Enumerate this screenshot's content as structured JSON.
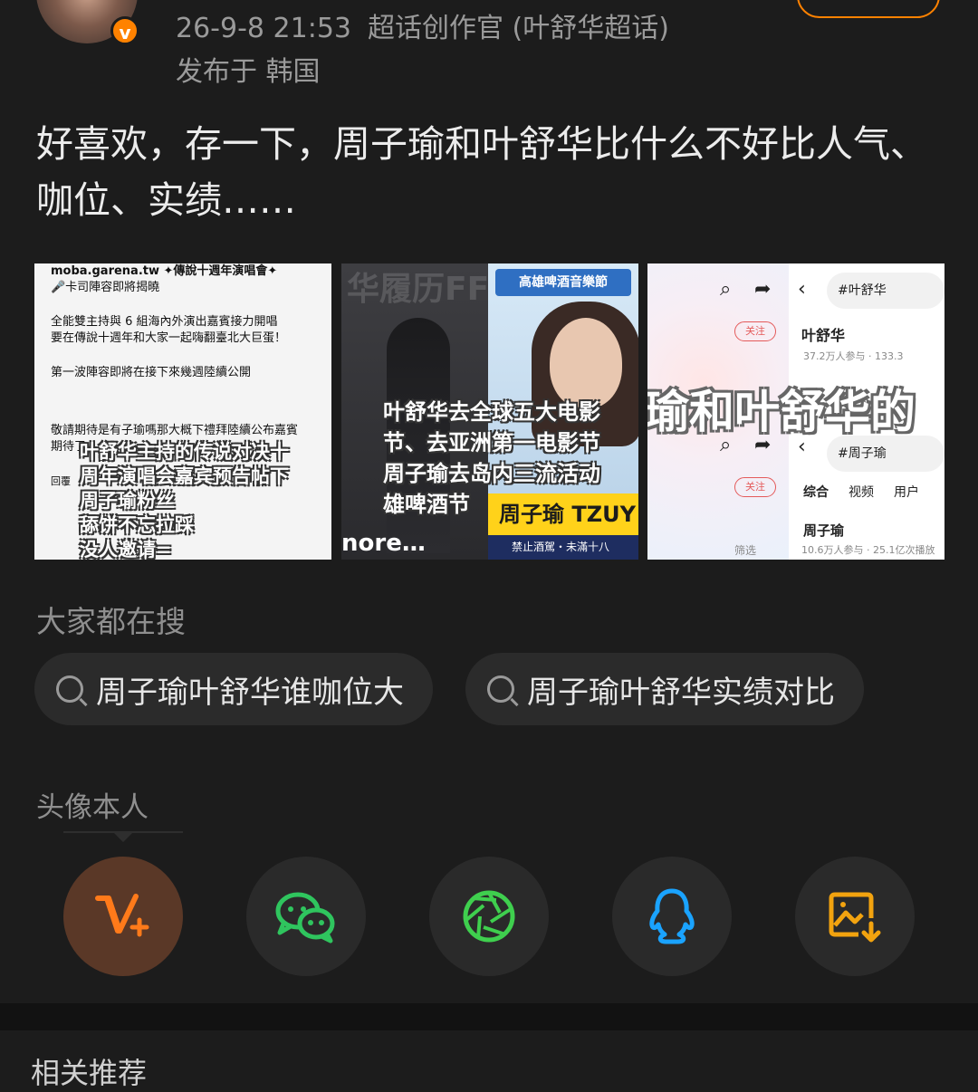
{
  "post": {
    "timestamp": "26-9-8 21:53",
    "source": "超话创作官 (叶舒华超话)",
    "location": "发布于 韩国",
    "text": "好喜欢，存一下，周子瑜和叶舒华比什么不好比人气、咖位、实绩……",
    "badge": "v"
  },
  "images": {
    "img1": {
      "lines": [
        "moba.garena.tw ✦傳說十週年演唱會✦",
        "🎤卡司陣容即將揭曉",
        "全能雙主持與 6 組海內外演出嘉賓接力開唱",
        "要在傳說十週年和大家一起嗨翻臺北大巨蛋！",
        "第一波陣容即將在接下來幾週陸續公開",
        "敬請期待是有子瑜嗎那大概下禮拜陸續公布嘉賓",
        "期待了",
        "回覆"
      ],
      "overlay": [
        "叶舒华主持的传说对决十",
        "周年演唱会嘉宾预告帖下",
        "周子瑜粉丝",
        "舔饼不忘拉踩",
        "没人邀请="
      ]
    },
    "img2": {
      "fest": "高雄啤酒音樂節",
      "watermark": "华履历FF",
      "overlay": [
        "叶舒华去全球五大电影",
        "节、去亚洲第一电影节",
        "周子瑜去岛内三流活动",
        "雄啤酒节"
      ],
      "name_tag": "周子瑜 TZUY",
      "more": "nore…",
      "strip": "禁止酒駕・未滿十八"
    },
    "img3": {
      "search1": "#叶舒华",
      "follow": "关注",
      "name1": "叶舒华",
      "stats1": "37.2万人参与 · 133.3",
      "overlay": "瑜和叶舒华的",
      "search2": "#周子瑜",
      "tabs": [
        "综合",
        "视频",
        "用户"
      ],
      "name2": "周子瑜",
      "filter": "筛选",
      "stats2": "10.6万人参与 · 25.1亿次播放"
    }
  },
  "search": {
    "title": "大家都在搜",
    "chips": [
      "周子瑜叶舒华谁咖位大",
      "周子瑜叶舒华实绩对比"
    ]
  },
  "share": {
    "label": "头像本人",
    "items": [
      {
        "icon": "weibo-vplus-icon",
        "color": "#ff7a1a"
      },
      {
        "icon": "wechat-icon",
        "color": "#2fc55e"
      },
      {
        "icon": "moments-icon",
        "color": "#3fcf4e"
      },
      {
        "icon": "qq-icon",
        "color": "#1aa3ff"
      },
      {
        "icon": "save-image-icon",
        "color": "#f2a30f"
      }
    ]
  },
  "related": {
    "label": "相关推荐"
  }
}
